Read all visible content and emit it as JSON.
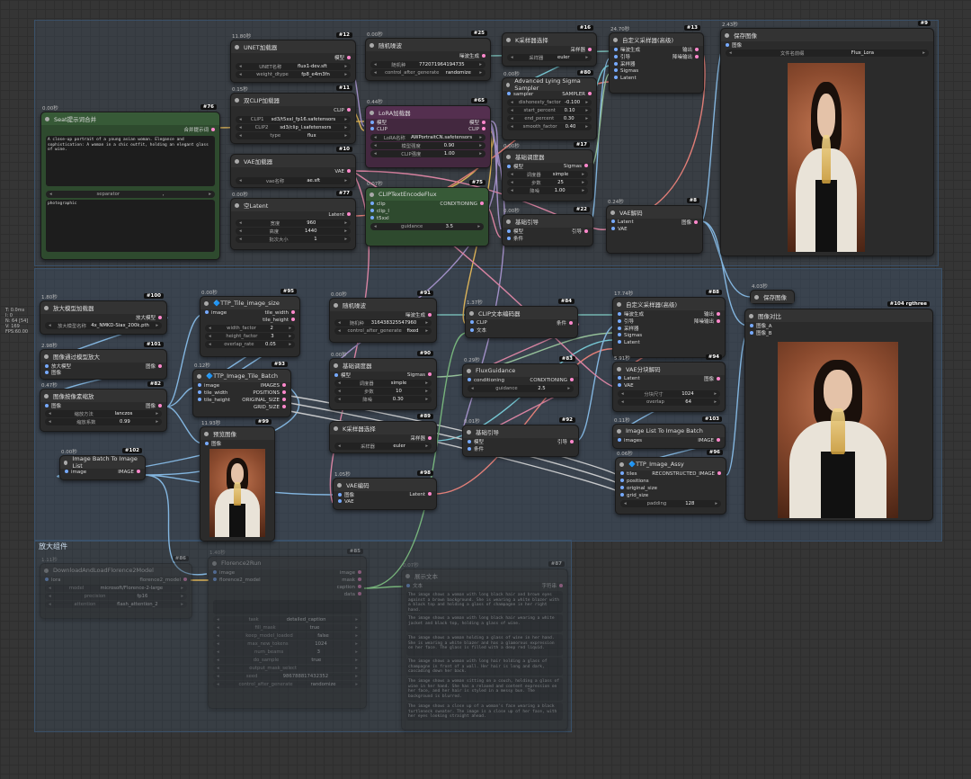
{
  "groups": {
    "g1": "",
    "g2": "",
    "g3": "放大组件"
  },
  "ctrl_lines": [
    "T: 0.0ms",
    "I: 0",
    "N: 64 [54]",
    "V: 169",
    "FPS:60.00"
  ],
  "n76": {
    "time": "0.00秒",
    "id": "#76",
    "title": "Seat提示词合并",
    "out": "合并提示词",
    "text1": "A close-up portrait of a young asian woman. Elegance and sophistication: A woman in a chic outfit, holding an elegant glass of wine.",
    "sep_label": "separator",
    "sep_val": ",",
    "text2": "photographic"
  },
  "n12": {
    "time": "11.80秒",
    "id": "#12",
    "title": "UNET加载器",
    "out": "模型",
    "w1l": "UNET名称",
    "w1v": "flux1-dev.sft",
    "w2l": "weight_dtype",
    "w2v": "fp8_e4m3fn"
  },
  "n11": {
    "time": "0.15秒",
    "id": "#11",
    "title": "双CLIP加载器",
    "out": "CLIP",
    "w1l": "CLIP1",
    "w1v": "sd3/t5xxl_fp16.safetensors",
    "w2l": "CLIP2",
    "w2v": "sd3/clip_l.safetensors",
    "w3l": "type",
    "w3v": "flux"
  },
  "n10": {
    "id": "#10",
    "title": "VAE加载器",
    "out": "VAE",
    "w1l": "vae名称",
    "w1v": "ae.sft"
  },
  "n77": {
    "time": "0.00秒",
    "id": "#77",
    "title": "空Latent",
    "out": "Latent",
    "w1l": "宽度",
    "w1v": "960",
    "w2l": "高度",
    "w2v": "1440",
    "w3l": "批次大小",
    "w3v": "1"
  },
  "n25": {
    "time": "0.00秒",
    "id": "#25",
    "title": "随机噪波",
    "out": "噪波生成",
    "w1l": "随机种",
    "w1v": "772071964194735",
    "w2l": "control_after_generate",
    "w2v": "randomize"
  },
  "n65": {
    "time": "0.44秒",
    "id": "#65",
    "title": "LoRA加载器",
    "in1": "模型",
    "in2": "CLIP",
    "out1": "模型",
    "out2": "CLIP",
    "w1l": "LoRA名称",
    "w1v": "AWPortraitCN.safetensors",
    "w2l": "模型强度",
    "w2v": "0.90",
    "w3l": "CLIP强度",
    "w3v": "1.00"
  },
  "n75": {
    "time": "0.07秒",
    "id": "#75",
    "title": "CLIPTextEncodeFlux",
    "in1": "clip",
    "in2": "clip_l",
    "in3": "t5xxl",
    "out": "CONDITIONING",
    "w1l": "guidance",
    "w1v": "3.5"
  },
  "n16": {
    "time": "",
    "id": "#16",
    "title": "K采样器选择",
    "out": "采样器",
    "w1l": "采样器",
    "w1v": "euler"
  },
  "n80": {
    "time": "0.00秒",
    "id": "#80",
    "title": "Advanced Lying Sigma Sampler",
    "in": "sampler",
    "out": "SAMPLER",
    "w1l": "dishonesty_factor",
    "w1v": "-0.100",
    "w2l": "start_percent",
    "w2v": "0.10",
    "w3l": "end_percent",
    "w3v": "0.30",
    "w4l": "smooth_factor",
    "w4v": "0.40"
  },
  "n17": {
    "time": "0.00秒",
    "id": "#17",
    "title": "基础调度器",
    "in": "模型",
    "out": "Sigmas",
    "w1l": "调度器",
    "w1v": "simple",
    "w2l": "步数",
    "w2v": "25",
    "w3l": "降噪",
    "w3v": "1.00"
  },
  "n22": {
    "time": "0.00秒",
    "id": "#22",
    "title": "基础引导",
    "in1": "模型",
    "in2": "条件",
    "out": "引导"
  },
  "n13": {
    "time": "24.70秒",
    "id": "#13",
    "title": "自定义采样器(高级)",
    "in1": "噪波生成",
    "in2": "引导",
    "in3": "采样器",
    "in4": "Sigmas",
    "in5": "Latent",
    "out1": "输出",
    "out2": "降噪输出"
  },
  "n8": {
    "time": "0.24秒",
    "id": "#8",
    "title": "VAE解码",
    "in1": "Latent",
    "in2": "VAE",
    "out": "图像"
  },
  "n9": {
    "time": "2.43秒",
    "id": "#9",
    "title": "保存图像",
    "in": "图像",
    "w1l": "文件名前缀",
    "w1v": "Flux_Lora"
  },
  "n100": {
    "time": "1.80秒",
    "id": "#100",
    "title": "放大模型加载器",
    "out": "放大模型",
    "w1l": "放大模型名称",
    "w1v": "4x_NMKD-Siax_200k.pth"
  },
  "n101": {
    "time": "2.98秒",
    "id": "#101",
    "title": "图像通过模型放大",
    "in1": "放大模型",
    "in2": "图像",
    "out": "图像"
  },
  "n82": {
    "time": "0.47秒",
    "id": "#82",
    "title": "图像按像素缩放",
    "in": "图像",
    "out": "图像",
    "w1l": "缩放方法",
    "w1v": "lanczos",
    "w2l": "缩放系数",
    "w2v": "0.99"
  },
  "n95": {
    "time": "0.00秒",
    "id": "#95",
    "title": "🔷TTP_Tile_image_size",
    "in": "image",
    "out1": "tile_width",
    "out2": "tile_height",
    "w1l": "width_factor",
    "w1v": "2",
    "w2l": "height_factor",
    "w2v": "3",
    "w3l": "overlap_rate",
    "w3v": "0.05"
  },
  "n93": {
    "time": "0.12秒",
    "id": "#93",
    "title": "🔷TTP_Image_Tile_Batch",
    "in1": "image",
    "in2": "tile_width",
    "in3": "tile_height",
    "out1": "IMAGES",
    "out2": "POSITIONS",
    "out3": "ORIGINAL_SIZE",
    "out4": "GRID_SIZE"
  },
  "n99": {
    "time": "11.93秒",
    "id": "#99",
    "title": "预览图像",
    "in": "图像"
  },
  "n102": {
    "time": "0.00秒",
    "id": "#102",
    "title": "Image Batch To Image List",
    "in": "image",
    "out": "IMAGE"
  },
  "n91": {
    "time": "0.00秒",
    "id": "#91",
    "title": "随机噪波",
    "out": "噪波生成",
    "w1l": "随机种",
    "w1v": "316438325547960",
    "w2l": "control_after_generate",
    "w2v": "fixed"
  },
  "n90": {
    "time": "0.00秒",
    "id": "#90",
    "title": "基础调度器",
    "in": "模型",
    "out": "Sigmas",
    "w1l": "调度器",
    "w1v": "simple",
    "w2l": "步数",
    "w2v": "10",
    "w3l": "降噪",
    "w3v": "0.30"
  },
  "n89": {
    "time": "",
    "id": "#89",
    "title": "K采样器选择",
    "out": "采样器",
    "w1l": "采样器",
    "w1v": "euler"
  },
  "n98": {
    "time": "1.05秒",
    "id": "#98",
    "title": "VAE编码",
    "in1": "图像",
    "in2": "VAE",
    "out": "Latent"
  },
  "n84": {
    "time": "1.37秒",
    "id": "#84",
    "title": "CLIP文本编码器",
    "in1": "CLIP",
    "in2": "文本",
    "out": "条件"
  },
  "n83": {
    "time": "0.29秒",
    "id": "#83",
    "title": "FluxGuidance",
    "in": "conditioning",
    "out": "CONDITIONING",
    "w1l": "guidance",
    "w1v": "2.5"
  },
  "n92": {
    "time": "0.01秒",
    "id": "#92",
    "title": "基础引导",
    "in1": "模型",
    "in2": "条件",
    "out": "引导"
  },
  "n88": {
    "time": "17.74秒",
    "id": "#88",
    "title": "自定义采样器(高级)",
    "in1": "噪波生成",
    "in2": "引导",
    "in3": "采样器",
    "in4": "Sigmas",
    "in5": "Latent",
    "out1": "输出",
    "out2": "降噪输出"
  },
  "n94": {
    "time": "5.91秒",
    "id": "#94",
    "title": "VAE分块解码",
    "in1": "Latent",
    "in2": "VAE",
    "out": "图像",
    "w1l": "分块尺寸",
    "w1v": "1024",
    "w2l": "overlap",
    "w2v": "64"
  },
  "n103": {
    "time": "0.11秒",
    "id": "#103",
    "title": "Image List To Image Batch",
    "in": "images",
    "out": "IMAGE"
  },
  "n96": {
    "time": "0.06秒",
    "id": "#96",
    "title": "🔷TTP_Image_Assy",
    "in1": "tiles",
    "in2": "positions",
    "in3": "original_size",
    "in4": "grid_size",
    "out": "RECONSTRUCTED_IMAGE",
    "w1l": "padding",
    "w1v": "128"
  },
  "n85b": {
    "time": "4.03秒",
    "id": "",
    "title": "保存图像"
  },
  "n104": {
    "id": "#104 rgthree",
    "title": "图像对比",
    "in1": "图像_A",
    "in2": "图像_B"
  },
  "n86": {
    "time": "1.11秒",
    "id": "#86",
    "title": "DownloadAndLoadFlorence2Model",
    "in": "lora",
    "out": "florence2_model",
    "w1l": "model",
    "w1v": "microsoft/Florence-2-large",
    "w2l": "precision",
    "w2v": "fp16",
    "w3l": "attention",
    "w3v": "flash_attention_2"
  },
  "n85": {
    "time": "1.40秒",
    "id": "#85",
    "title": "Florence2Run",
    "in1": "image",
    "in2": "florence2_model",
    "out1": "image",
    "out2": "mask",
    "out3": "caption",
    "out4": "data",
    "text": "",
    "w1l": "task",
    "w1v": "detailed_caption",
    "w2l": "fill_mask",
    "w2v": "true",
    "w3l": "keep_model_loaded",
    "w3v": "false",
    "w4l": "max_new_tokens",
    "w4v": "1024",
    "w5l": "num_beams",
    "w5v": "3",
    "w6l": "do_sample",
    "w6v": "true",
    "w7l": "output_mask_select",
    "w7v": "",
    "w8l": "seed",
    "w8v": "986788817432352",
    "w9l": "control_after_generate",
    "w9v": "randomize"
  },
  "n87": {
    "time": "0.07秒",
    "id": "#87",
    "title": "展示文本",
    "in": "文本",
    "out": "字符串",
    "paras": [
      "The image shows a woman with long black hair and brown eyes against a brown background. She is wearing a white blazer with a black top and holding a glass of champagne in her right hand.",
      "The image shows a woman with long black hair wearing a white jacket and black top, holding a glass of wine.",
      "The image shows a woman holding a glass of wine in her hand. She is wearing a white blazer and has a glamorous expression on her face. The glass is filled with a deep red liquid.",
      "The image shows a woman with long hair holding a glass of champagne in front of a wall. Her hair is long and dark, cascading down her back.",
      "The image shows a woman sitting on a couch, holding a glass of wine in her hand. She has a relaxed and content expression on her face, and her hair is styled in a messy bun. The background is blurred.",
      "The image shows a close up of a woman's face wearing a black turtleneck sweater. The image is a close up of her face, with her eyes looking straight ahead."
    ]
  }
}
